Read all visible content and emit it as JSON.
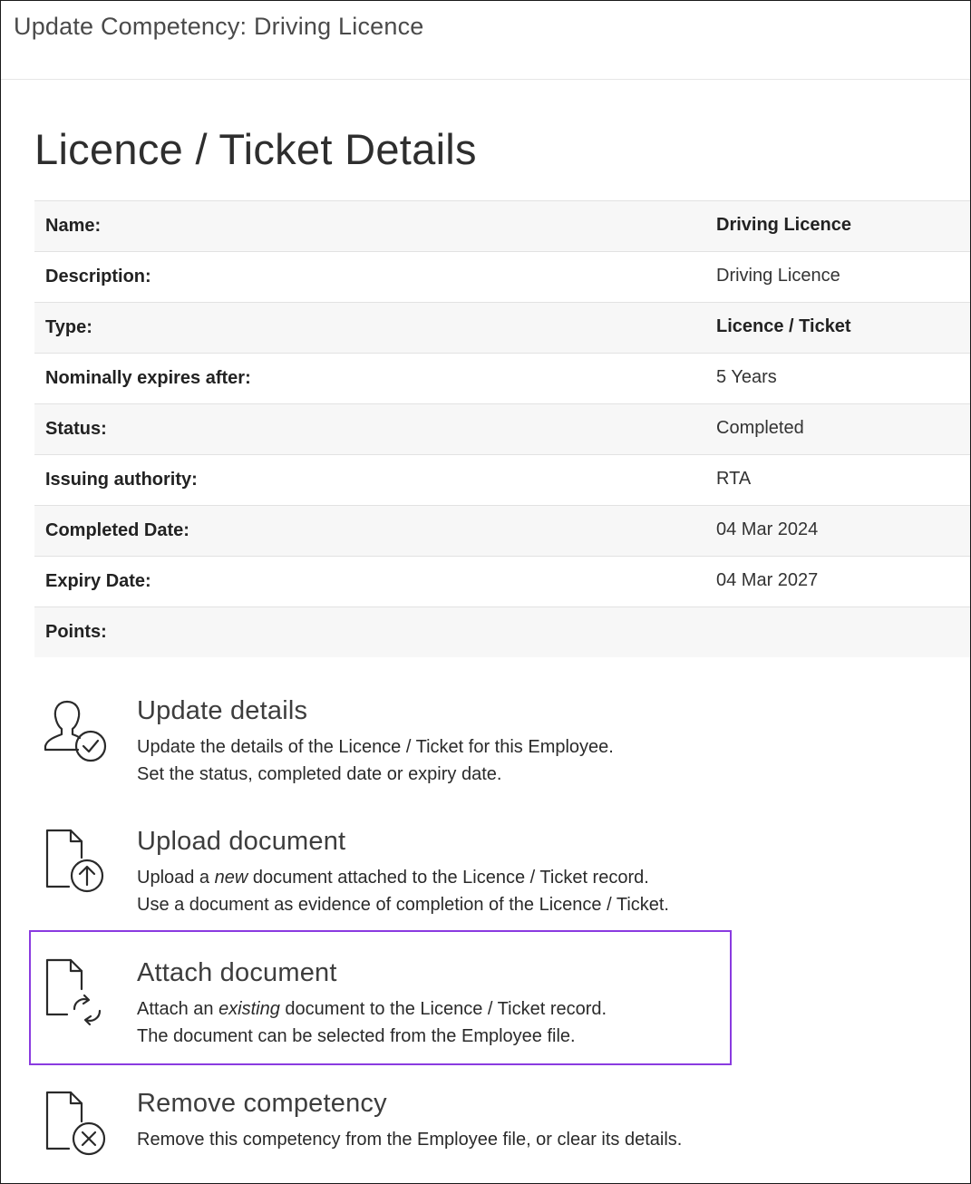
{
  "modal": {
    "title": "Update Competency: Driving Licence"
  },
  "section": {
    "title": "Licence / Ticket Details"
  },
  "details": [
    {
      "label": "Name:",
      "value": "Driving Licence"
    },
    {
      "label": "Description:",
      "value": "Driving Licence"
    },
    {
      "label": "Type:",
      "value": "Licence / Ticket"
    },
    {
      "label": "Nominally expires after:",
      "value": "5 Years"
    },
    {
      "label": "Status:",
      "value": "Completed"
    },
    {
      "label": "Issuing authority:",
      "value": "RTA"
    },
    {
      "label": "Completed Date:",
      "value": "04 Mar 2024"
    },
    {
      "label": "Expiry Date:",
      "value": "04 Mar 2027"
    },
    {
      "label": "Points:",
      "value": ""
    }
  ],
  "actions": {
    "update": {
      "icon": "user-check-icon",
      "title": "Update details",
      "line1": "Update the details of the Licence / Ticket for this Employee.",
      "line2": "Set the status, completed date or expiry date."
    },
    "upload": {
      "icon": "document-upload-icon",
      "title": "Upload document",
      "line1_pre": "Upload a ",
      "line1_em": "new",
      "line1_post": " document attached to the Licence / Ticket record.",
      "line2": "Use a document as evidence of completion of the Licence / Ticket."
    },
    "attach": {
      "icon": "document-attach-icon",
      "title": "Attach document",
      "line1_pre": "Attach an ",
      "line1_em": "existing",
      "line1_post": " document to the Licence / Ticket record.",
      "line2": "The document can be selected from the Employee file."
    },
    "remove": {
      "icon": "document-remove-icon",
      "title": "Remove competency",
      "line1": "Remove this competency from the Employee file, or clear its details."
    }
  },
  "colors": {
    "highlight": "#8a3be0",
    "row_shade": "#f7f7f7"
  }
}
